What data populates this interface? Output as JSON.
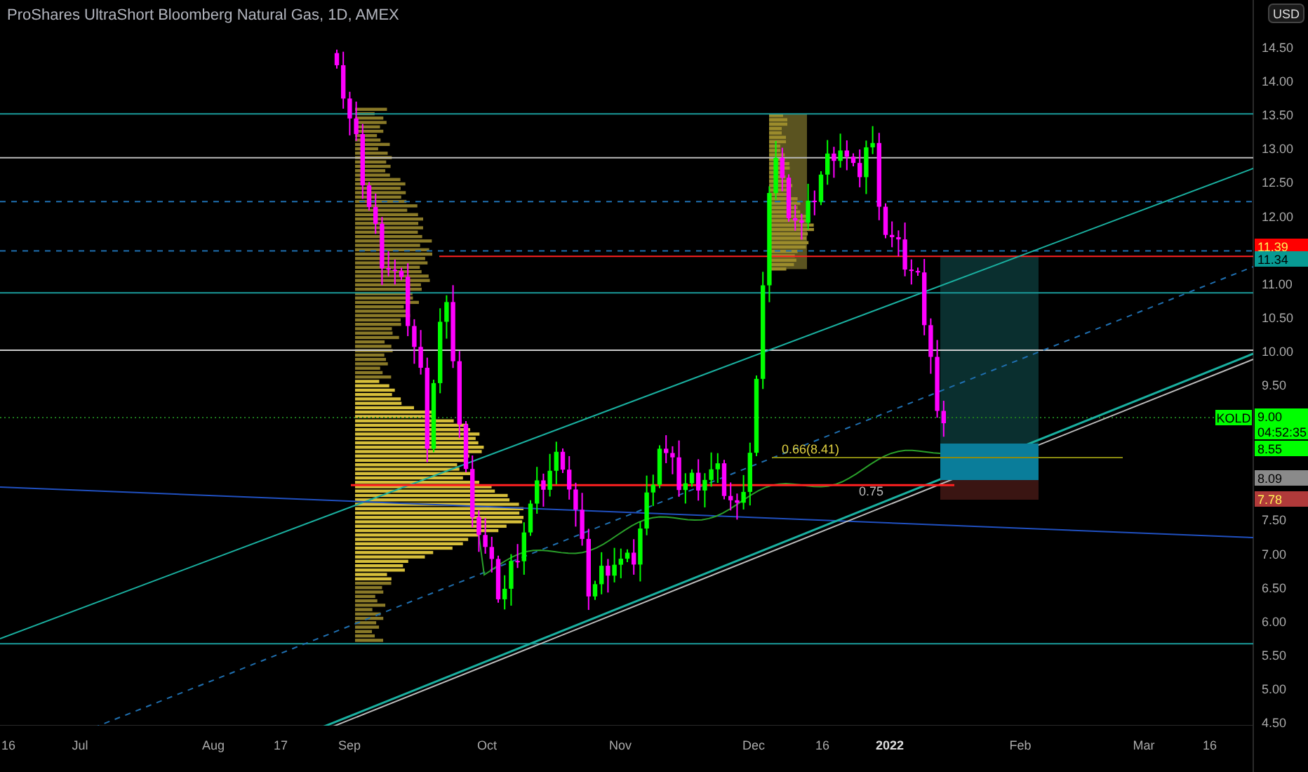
{
  "title": "ProShares UltraShort Bloomberg Natural Gas, 1D, AMEX",
  "currency": "USD",
  "price_axis": [
    "14.50",
    "14.00",
    "13.50",
    "13.00",
    "12.50",
    "12.00",
    "11.00",
    "10.50",
    "10.00",
    "9.50",
    "7.50",
    "7.00",
    "6.50",
    "6.00",
    "5.50",
    "5.00",
    "4.50"
  ],
  "time_axis": [
    {
      "label": "16",
      "bold": false
    },
    {
      "label": "Jul",
      "bold": false
    },
    {
      "label": "Aug",
      "bold": false
    },
    {
      "label": "17",
      "bold": false
    },
    {
      "label": "Sep",
      "bold": false
    },
    {
      "label": "Oct",
      "bold": false
    },
    {
      "label": "Nov",
      "bold": false
    },
    {
      "label": "Dec",
      "bold": false
    },
    {
      "label": "16",
      "bold": false
    },
    {
      "label": "2022",
      "bold": true
    },
    {
      "label": "Feb",
      "bold": false
    },
    {
      "label": "Mar",
      "bold": false
    },
    {
      "label": "16",
      "bold": false
    }
  ],
  "symbol_tag": {
    "text": "KOLD",
    "color": "#00ff00"
  },
  "price_tags": [
    {
      "text": "11.39",
      "color": "#ff0000"
    },
    {
      "text": "11.34",
      "color": "#089a93"
    },
    {
      "text": "9.00",
      "subtext": "04:52:35",
      "color": "#00ff00"
    },
    {
      "text": "8.55",
      "color": "#00ff00"
    },
    {
      "text": "8.09",
      "color": "#8a8a8a"
    },
    {
      "text": "7.78",
      "color": "#b03a3a"
    }
  ],
  "annotations": [
    "0.66(8.41)",
    "0.75"
  ]
}
